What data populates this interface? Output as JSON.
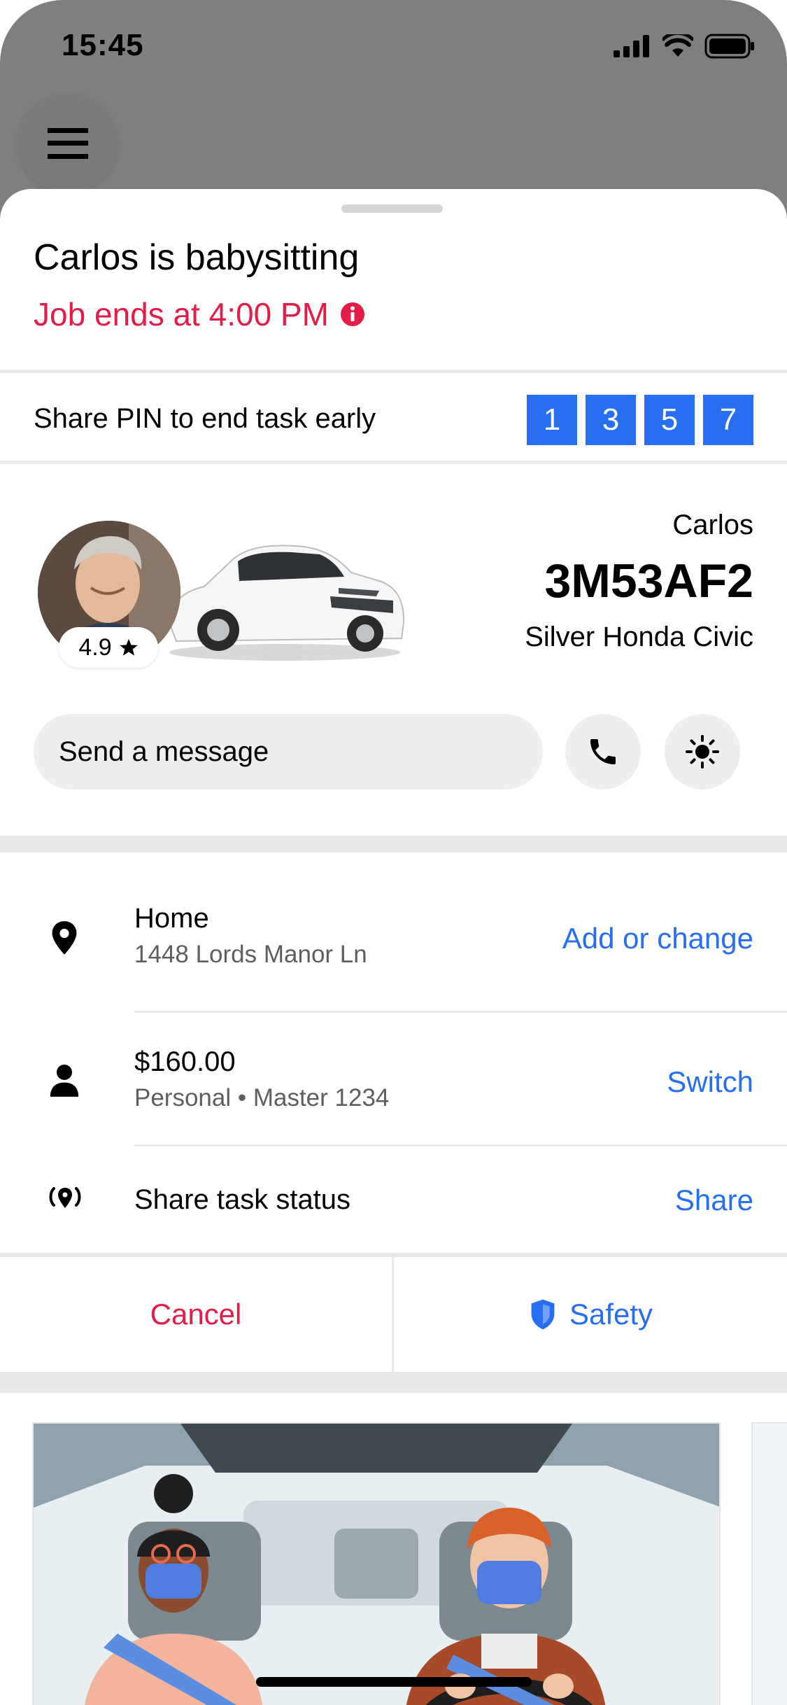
{
  "status_bar": {
    "time": "15:45"
  },
  "header": {
    "title": "Carlos is babysitting",
    "subtitle": "Job ends at 4:00 PM"
  },
  "pin": {
    "label": "Share PIN to end task early",
    "digits": [
      "1",
      "3",
      "5",
      "7"
    ]
  },
  "driver": {
    "name": "Carlos",
    "plate": "3M53AF2",
    "vehicle": "Silver Honda Civic",
    "rating": "4.9"
  },
  "message": {
    "placeholder": "Send a message"
  },
  "rows": {
    "location": {
      "title": "Home",
      "subtitle": "1448 Lords Manor Ln",
      "action": "Add or change"
    },
    "payment": {
      "title": "$160.00",
      "subtitle": "Personal • Master 1234",
      "action": "Switch"
    },
    "share": {
      "title": "Share task status",
      "action": "Share"
    }
  },
  "actions": {
    "cancel": "Cancel",
    "safety": "Safety"
  },
  "colors": {
    "accent": "#276ef1",
    "alert": "#e11d48",
    "divider": "#e9e9e9"
  },
  "icons": [
    "menu-icon",
    "info-icon",
    "star-icon",
    "phone-icon",
    "sun-icon",
    "location-pin-icon",
    "person-icon",
    "broadcast-icon",
    "shield-icon",
    "signal-icon",
    "wifi-icon",
    "battery-icon"
  ]
}
